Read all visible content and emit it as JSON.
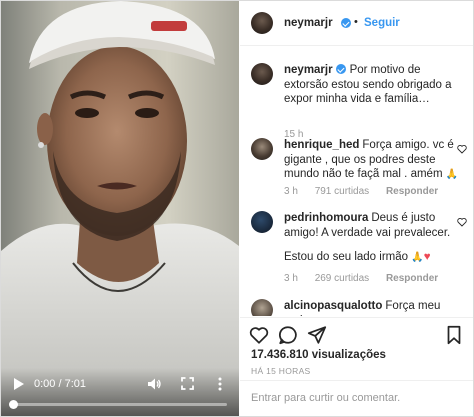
{
  "video": {
    "time_label": "0:00 / 7:01",
    "progress_fraction": 0.0
  },
  "header": {
    "username": "neymarjr",
    "separator": "•",
    "follow_label": "Seguir"
  },
  "caption": {
    "username": "neymarjr",
    "text": "Por motivo de extorsão estou sendo obrigado a expor minha vida e família…",
    "time": "15 h"
  },
  "comments": [
    {
      "username": "henrique_hed",
      "text": "Força amigo. vc é gigante , que os podres deste mundo não te façã mal . amém",
      "emoji": "🙏",
      "time": "3 h",
      "likes": "791 curtidas",
      "reply": "Responder"
    },
    {
      "username": "pedrinhomoura",
      "text": "Deus é justo amigo! A verdade vai prevalecer.",
      "text2": "Estou do seu lado irmão",
      "emoji": "🙏",
      "emoji2": "♥",
      "time": "3 h",
      "likes": "269 curtidas",
      "reply": "Responder"
    },
    {
      "username": "alcinopasqualotto",
      "text": "Força meu amigo…"
    }
  ],
  "stats": {
    "views": "17.436.810 visualizações",
    "age": "HÁ 15 HORAS"
  },
  "add_comment": {
    "placeholder": "Entrar para curtir ou comentar.",
    "publish": ""
  },
  "colors": {
    "link_blue": "#3897f0",
    "muted_text": "#999999",
    "border": "#efefef",
    "heart_red": "#ed4956"
  },
  "icons": [
    "play-icon",
    "volume-icon",
    "fullscreen-icon",
    "more-vertical-icon",
    "verified-badge-icon",
    "heart-icon",
    "comment-icon",
    "share-icon",
    "bookmark-icon"
  ]
}
